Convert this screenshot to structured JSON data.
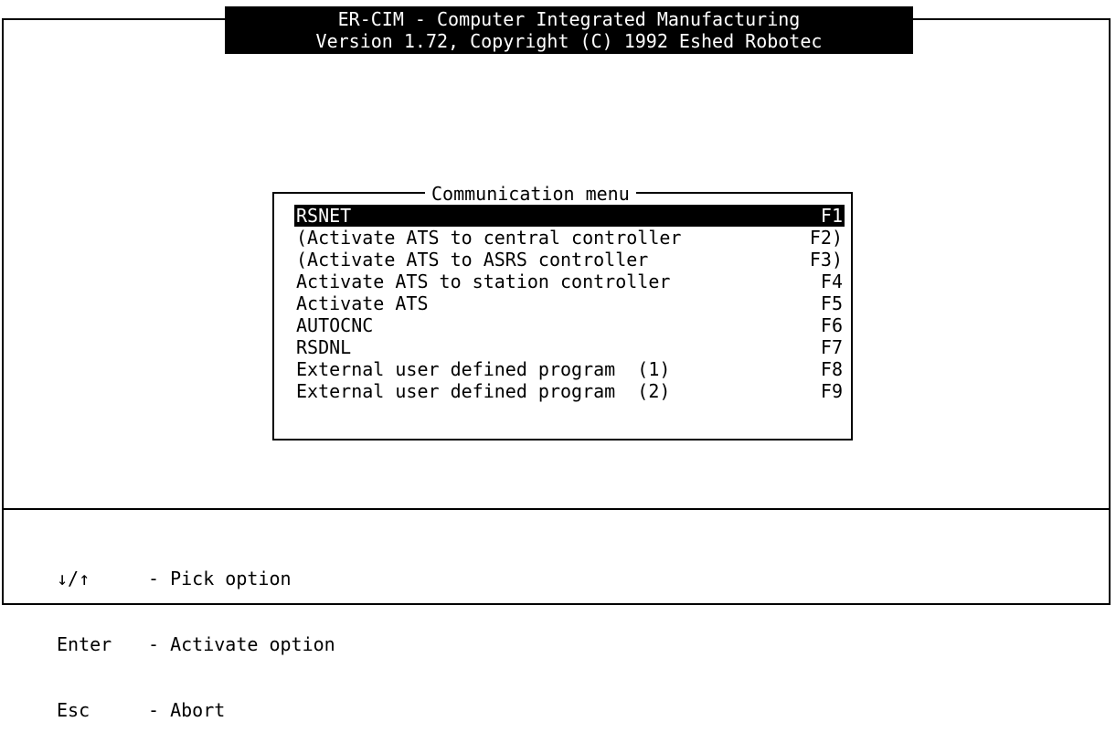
{
  "header": {
    "line1": "ER-CIM - Computer Integrated Manufacturing",
    "line2": "Version 1.72, Copyright (C) 1992 Eshed Robotec"
  },
  "menu": {
    "title": "Communication menu",
    "items": [
      {
        "label": "RSNET",
        "key": "F1",
        "selected": true
      },
      {
        "label": "(Activate ATS to central controller",
        "key": "F2)"
      },
      {
        "label": "(Activate ATS to ASRS controller",
        "key": "F3)"
      },
      {
        "label": "Activate ATS to station controller",
        "key": "F4"
      },
      {
        "label": "Activate ATS",
        "key": "F5"
      },
      {
        "label": "AUTOCNC",
        "key": "F6"
      },
      {
        "label": "RSDNL",
        "key": "F7"
      },
      {
        "label": "External user defined program  (1)",
        "key": "F8"
      },
      {
        "label": "External user defined program  (2)",
        "key": "F9"
      }
    ]
  },
  "help": [
    {
      "key": "↓/↑",
      "desc": "- Pick option"
    },
    {
      "key": "Enter",
      "desc": "- Activate option"
    },
    {
      "key": "Esc",
      "desc": "- Abort"
    }
  ]
}
